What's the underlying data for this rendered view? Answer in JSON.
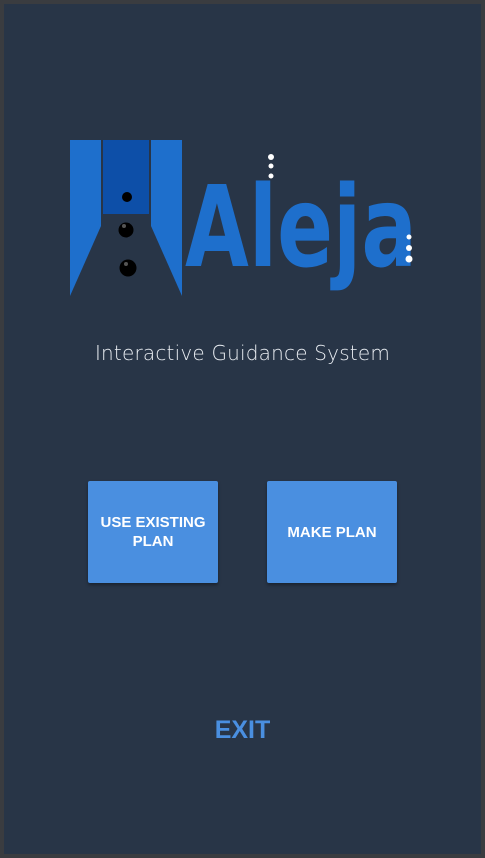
{
  "app": {
    "logo_text": "Aleja",
    "tagline": "Interactive Guidance System"
  },
  "buttons": {
    "use_existing_plan": "USE EXISTING PLAN",
    "make_plan": "MAKE PLAN",
    "exit": "EXIT"
  },
  "colors": {
    "background": "#283547",
    "button": "#4a8fe0",
    "logo_blue": "#1e6fcc",
    "logo_dark_blue": "#0d4fa8",
    "tagline_text": "#e9edf2"
  }
}
